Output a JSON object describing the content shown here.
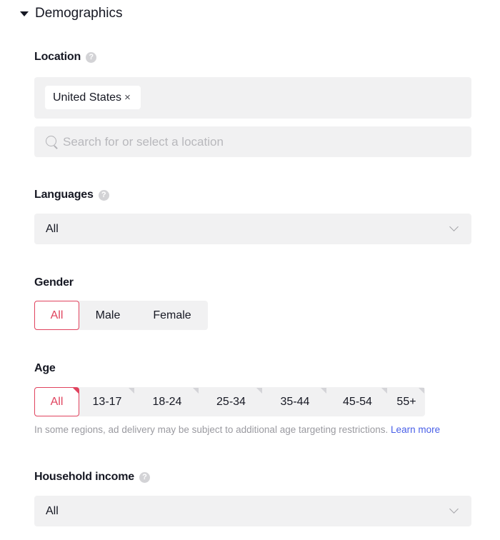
{
  "section": {
    "title": "Demographics",
    "expanded": true,
    "caret_icon": "caret-down-icon"
  },
  "location": {
    "label": "Location",
    "help_icon": "?",
    "selected_tags": [
      {
        "label": "United States",
        "remove_icon": "×"
      }
    ],
    "search_placeholder": "Search for or select a location"
  },
  "languages": {
    "label": "Languages",
    "help_icon": "?",
    "value": "All"
  },
  "gender": {
    "label": "Gender",
    "options": [
      "All",
      "Male",
      "Female"
    ],
    "selected": "All"
  },
  "age": {
    "label": "Age",
    "options": [
      "All",
      "13-17",
      "18-24",
      "25-34",
      "35-44",
      "45-54",
      "55+"
    ],
    "selected": "All",
    "hint": "In some regions, ad delivery may be subject to additional age targeting restrictions.",
    "learn_more": "Learn more"
  },
  "household_income": {
    "label": "Household income",
    "help_icon": "?",
    "value": "All"
  },
  "colors": {
    "accent": "#e0435e",
    "link": "#4a60e8",
    "field_bg": "#f1f1f2"
  }
}
